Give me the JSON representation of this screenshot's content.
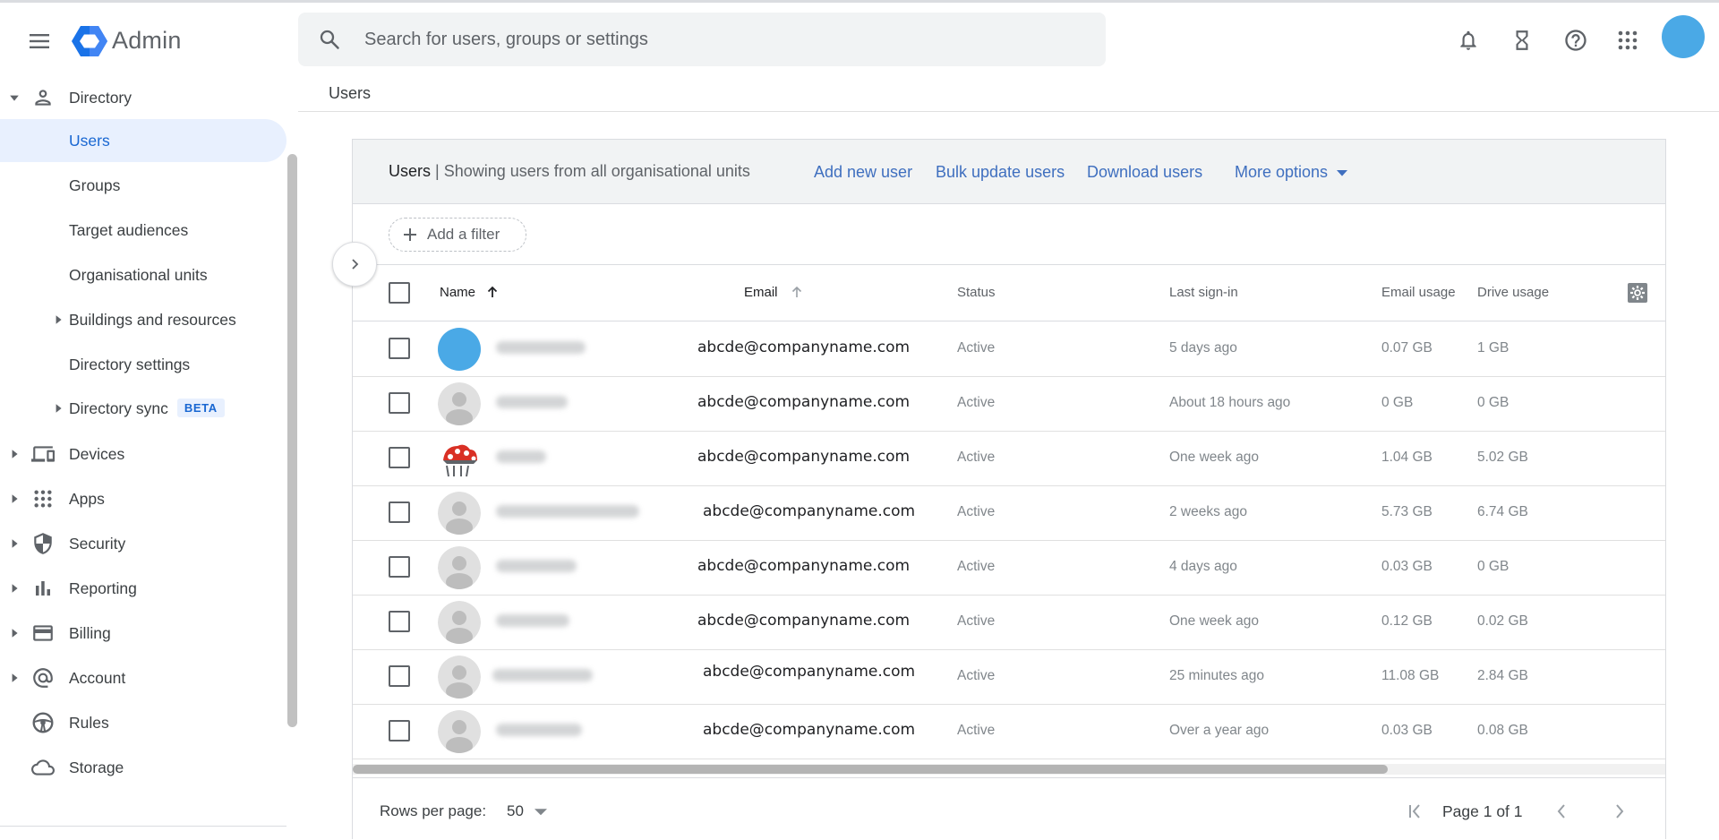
{
  "app": {
    "brand": "Admin"
  },
  "search": {
    "placeholder": "Search for users, groups or settings"
  },
  "header_icons": [
    "bell-icon",
    "hourglass-icon",
    "help-icon",
    "apps-grid-icon"
  ],
  "sidebar": {
    "directory": {
      "label": "Directory",
      "children": [
        {
          "label": "Users"
        },
        {
          "label": "Groups"
        },
        {
          "label": "Target audiences"
        },
        {
          "label": "Organisational units"
        },
        {
          "label": "Buildings and resources"
        },
        {
          "label": "Directory settings"
        },
        {
          "label": "Directory sync",
          "badge": "BETA"
        }
      ]
    },
    "items": [
      {
        "label": "Devices"
      },
      {
        "label": "Apps"
      },
      {
        "label": "Security"
      },
      {
        "label": "Reporting"
      },
      {
        "label": "Billing"
      },
      {
        "label": "Account"
      },
      {
        "label": "Rules"
      },
      {
        "label": "Storage"
      }
    ]
  },
  "breadcrumb": "Users",
  "card": {
    "title_bold": "Users",
    "title_rest": " | Showing users from all organisational units",
    "actions": [
      "Add new user",
      "Bulk update users",
      "Download users",
      "More options"
    ],
    "filter_label": "Add a filter"
  },
  "table": {
    "columns": [
      "Name",
      "Email",
      "Status",
      "Last sign-in",
      "Email usage",
      "Drive usage"
    ],
    "rows": [
      {
        "email": "abcde@companyname.com",
        "status": "Active",
        "last_signin": "5 days ago",
        "email_usage": "0.07 GB",
        "drive_usage": "1 GB"
      },
      {
        "email": "abcde@companyname.com",
        "status": "Active",
        "last_signin": "About 18 hours ago",
        "email_usage": "0 GB",
        "drive_usage": "0 GB"
      },
      {
        "email": "abcde@companyname.com",
        "status": "Active",
        "last_signin": "One week ago",
        "email_usage": "1.04 GB",
        "drive_usage": "5.02 GB"
      },
      {
        "email": "abcde@companyname.com",
        "status": "Active",
        "last_signin": "2 weeks ago",
        "email_usage": "5.73 GB",
        "drive_usage": "6.74 GB"
      },
      {
        "email": "abcde@companyname.com",
        "status": "Active",
        "last_signin": "4 days ago",
        "email_usage": "0.03 GB",
        "drive_usage": "0 GB"
      },
      {
        "email": "abcde@companyname.com",
        "status": "Active",
        "last_signin": "One week ago",
        "email_usage": "0.12 GB",
        "drive_usage": "0.02 GB"
      },
      {
        "email": "abcde@companyname.com",
        "status": "Active",
        "last_signin": "25 minutes ago",
        "email_usage": "11.08 GB",
        "drive_usage": "2.84 GB"
      },
      {
        "email": "abcde@companyname.com",
        "status": "Active",
        "last_signin": "Over a year ago",
        "email_usage": "0.03 GB",
        "drive_usage": "0.08 GB"
      }
    ]
  },
  "footer": {
    "rows_per_page_label": "Rows per page:",
    "rows_per_page_value": "50",
    "page_text": "Page 1 of 1"
  },
  "colors": {
    "accent": "#1a73e8",
    "selected_bg": "#e8f0fe",
    "avatar": "#4aa9e6"
  }
}
